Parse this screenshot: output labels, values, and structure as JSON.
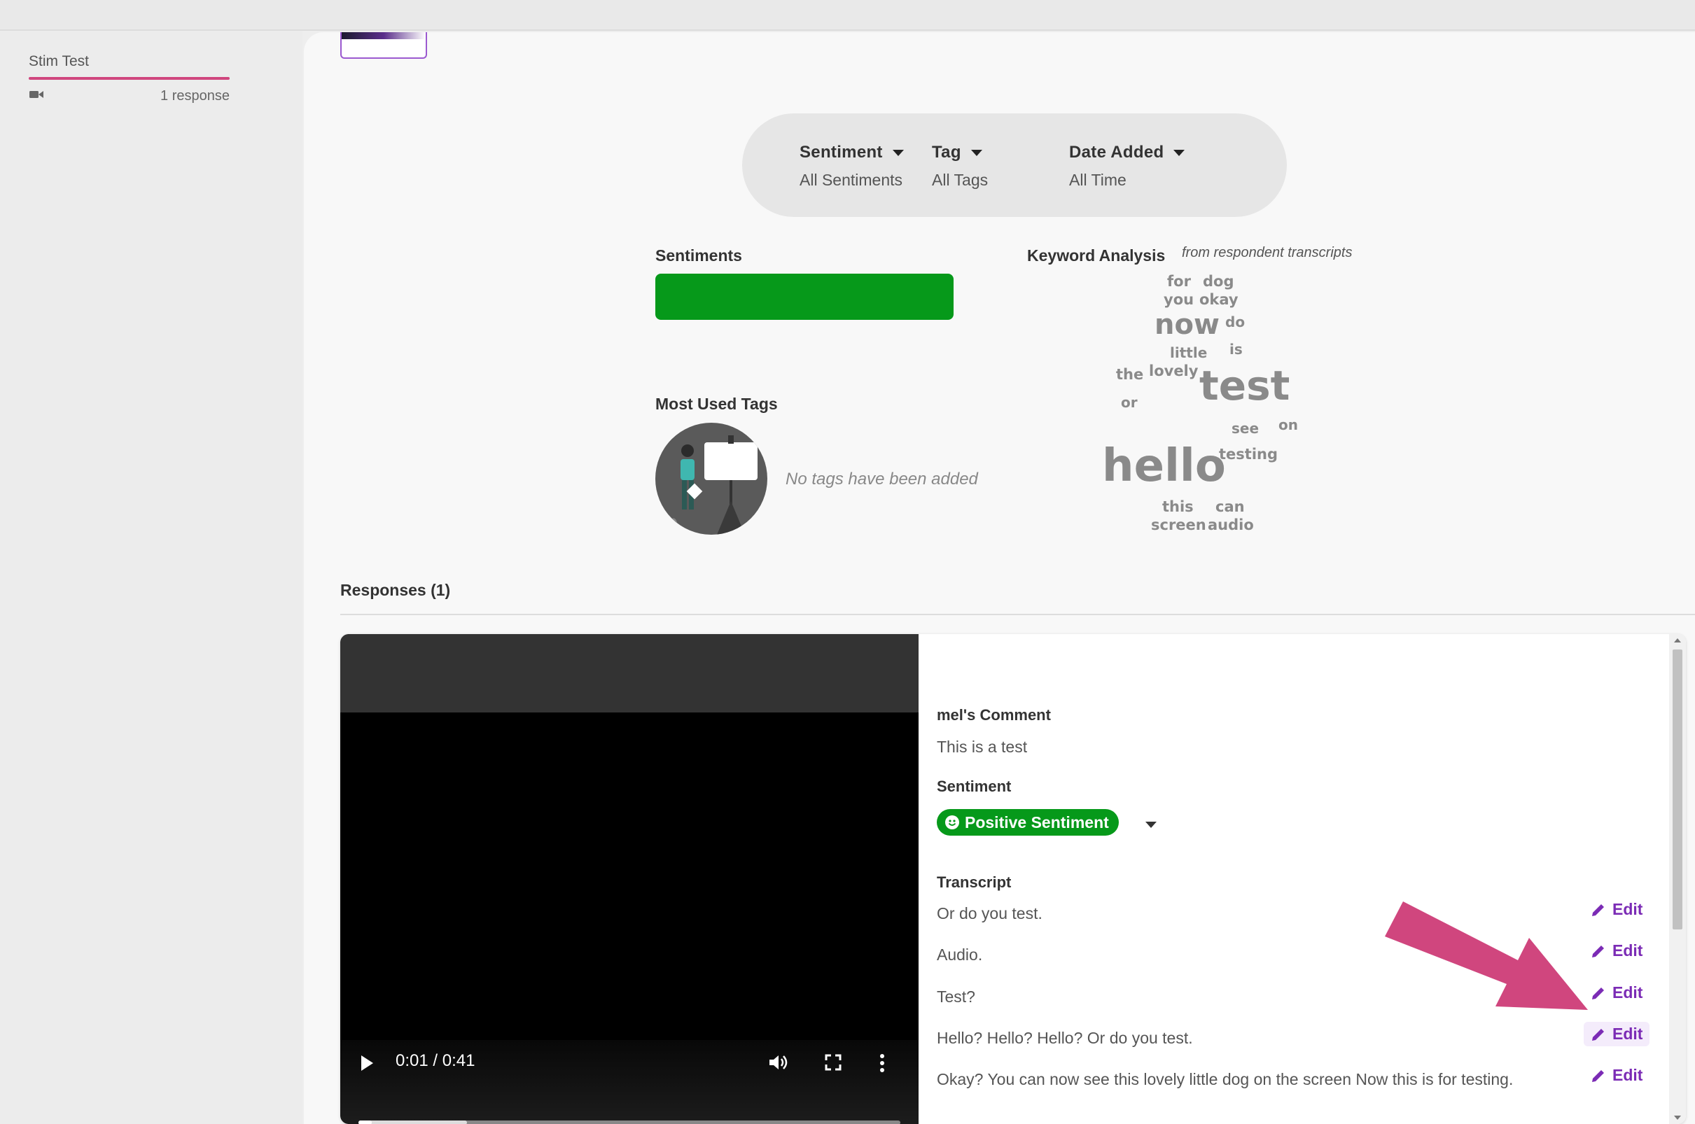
{
  "sidebar": {
    "stim_name": "Stim Test",
    "response_count": "1 response",
    "media_icon": "video-camera-icon"
  },
  "filters": [
    {
      "label": "Sentiment",
      "value": "All Sentiments"
    },
    {
      "label": "Tag",
      "value": "All Tags"
    },
    {
      "label": "Date Added",
      "value": "All Time"
    }
  ],
  "sentiments": {
    "title": "Sentiments",
    "positive_fraction": 1.0,
    "bar_color": "#06991a"
  },
  "keyword_analysis": {
    "title": "Keyword Analysis",
    "subtitle": "from respondent transcripts",
    "words": [
      "for",
      "dog",
      "you",
      "okay",
      "now",
      "do",
      "little",
      "is",
      "the",
      "lovely",
      "test",
      "or",
      "see",
      "on",
      "hello",
      "testing",
      "this",
      "can",
      "screen",
      "audio"
    ]
  },
  "tags": {
    "title": "Most Used Tags",
    "empty_text": "No tags have been added"
  },
  "responses": {
    "title": "Responses (1)",
    "video": {
      "current_time": "0:01 / 0:41",
      "played_fraction": 0.024,
      "buffered_fraction": 0.2
    },
    "comment_title": "mel's Comment",
    "comment_text": "This is a test",
    "sentiment_title": "Sentiment",
    "sentiment_value": "Positive Sentiment",
    "sentiment_color": "#06991a",
    "transcript_title": "Transcript",
    "edit_label": "Edit",
    "transcript": [
      "Or do you test.",
      "Audio.",
      "Test?",
      "Hello? Hello? Hello? Or do you test.",
      "Okay? You can now see this lovely little dog on the screen Now this is for testing."
    ]
  },
  "accent_color": "#7b2bb5",
  "annotation_arrow_color": "#d0467e"
}
